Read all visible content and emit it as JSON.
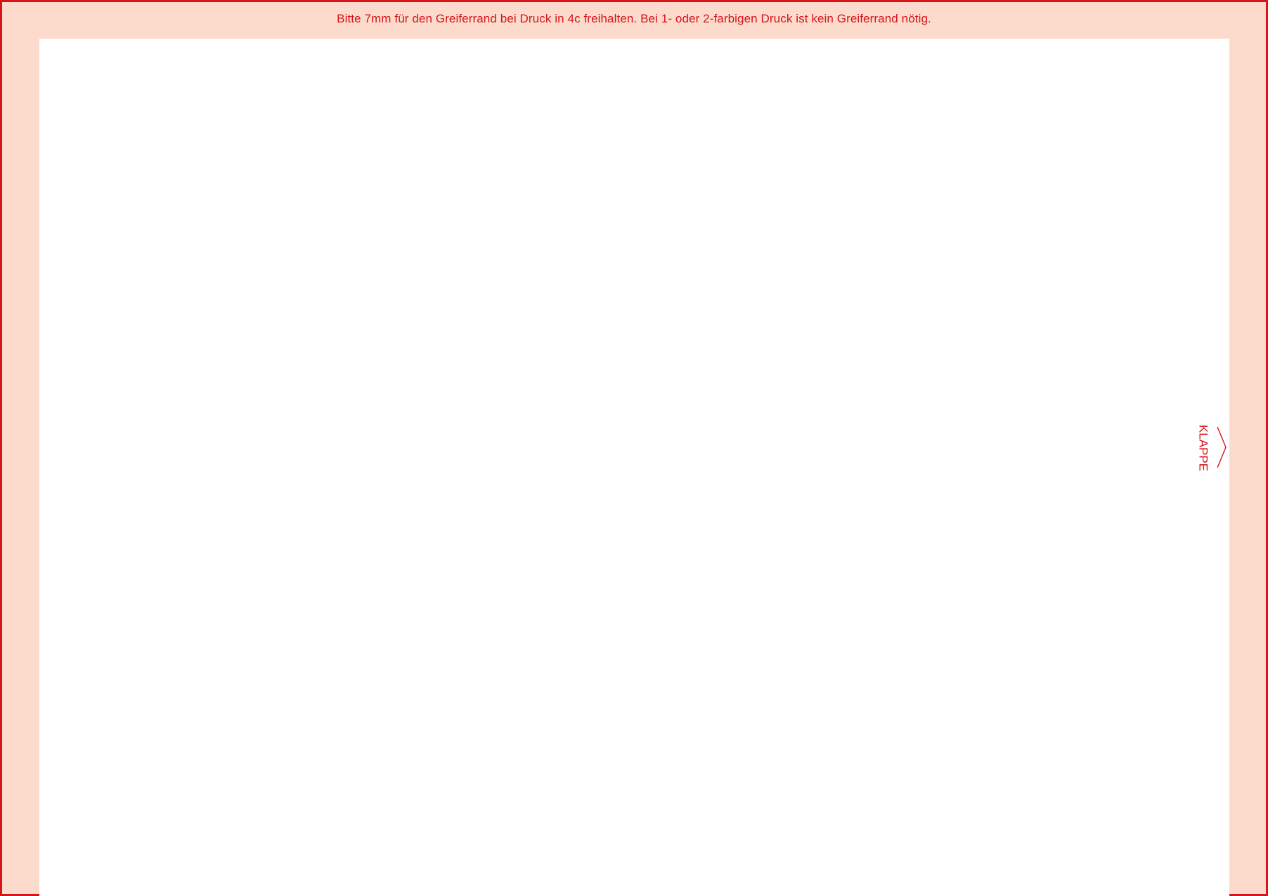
{
  "note": {
    "text": "Bitte 7mm für den Greiferrand bei Druck in 4c freihalten. Bei 1- oder 2-farbigen Druck ist kein Greiferrand nötig."
  },
  "flap": {
    "label": "KLAPPE",
    "icon": "chevron-right-icon"
  },
  "colors": {
    "accent": "#d7141a",
    "margin_fill": "#fcdbcc",
    "print_area": "#ffffff"
  }
}
